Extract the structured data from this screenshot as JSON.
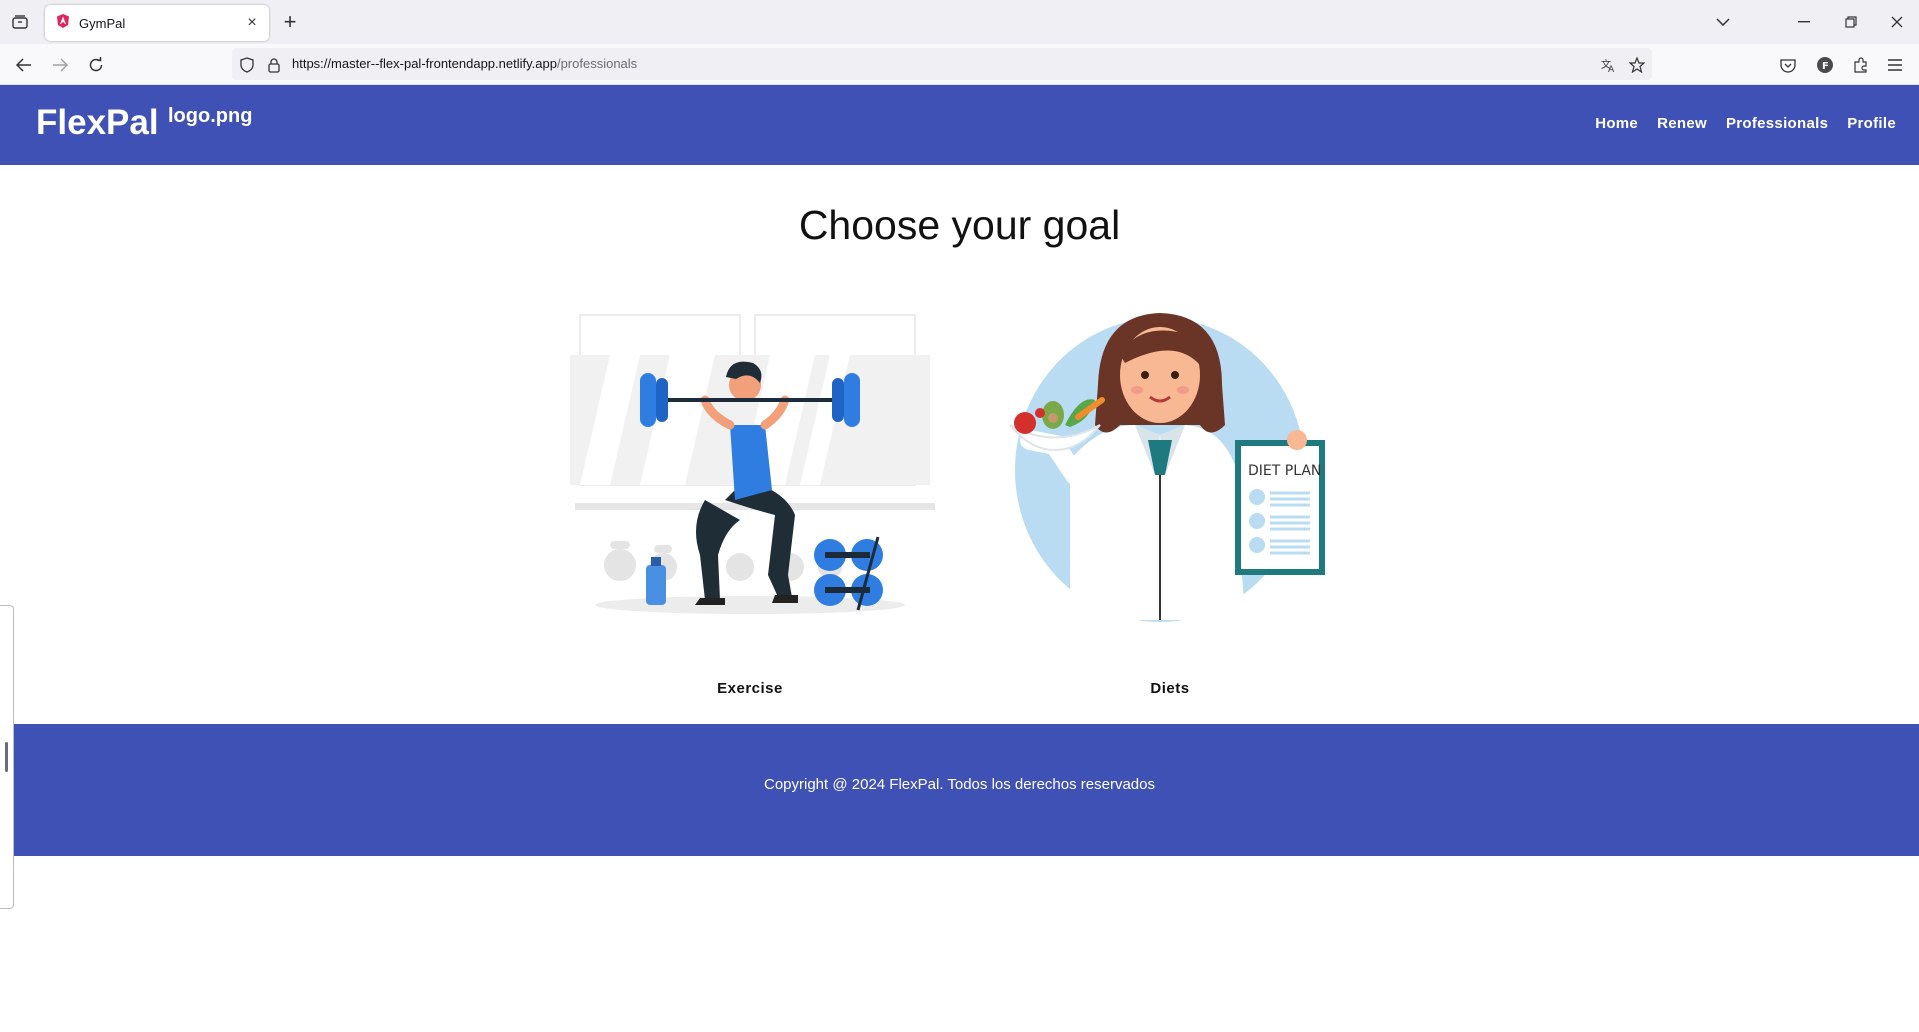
{
  "browser": {
    "tab_title": "GymPal",
    "url_host": "https://master--flex-pal-frontendapp.netlify.app",
    "url_path": "/professionals"
  },
  "site": {
    "brand": "FlexPal",
    "logo_alt": "logo.png",
    "nav": [
      "Home",
      "Renew",
      "Professionals",
      "Profile"
    ]
  },
  "main": {
    "heading": "Choose your goal",
    "cards": [
      {
        "label": "Exercise",
        "illustration": "man-lifting-barbell"
      },
      {
        "label": "Diets",
        "illustration": "nutritionist-diet-plan",
        "sign_text": "DIET PLAN"
      }
    ]
  },
  "footer": {
    "text": "Copyright @ 2024 FlexPal. Todos los derechos reservados"
  },
  "colors": {
    "primary": "#3f51b5",
    "accent_blue": "#2f7de1",
    "light_blue": "#b9dcf3"
  }
}
